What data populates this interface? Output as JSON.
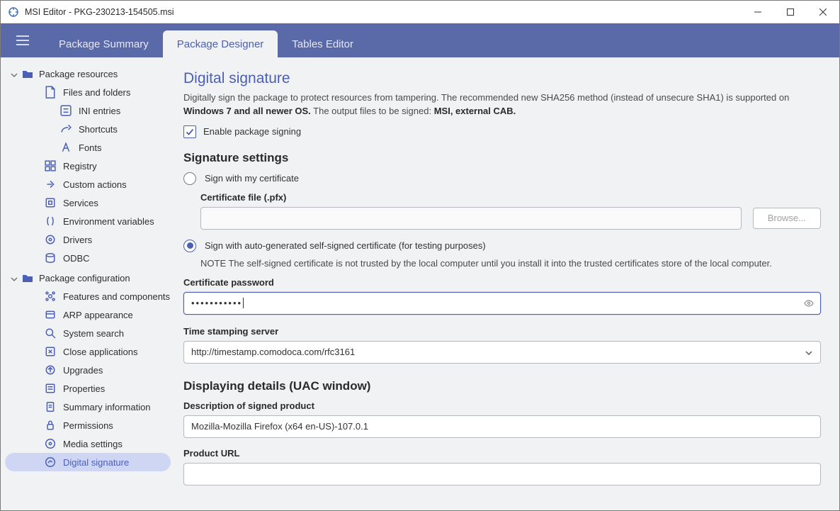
{
  "window": {
    "title": "MSI Editor - PKG-230213-154505.msi"
  },
  "topnav": {
    "tabs": [
      {
        "label": "Package Summary",
        "active": false
      },
      {
        "label": "Package Designer",
        "active": true
      },
      {
        "label": "Tables Editor",
        "active": false
      }
    ]
  },
  "sidebar": {
    "groups": [
      {
        "label": "Package resources",
        "items": [
          {
            "id": "files-folders",
            "label": "Files and folders",
            "icon": "file-icon",
            "children": [
              {
                "id": "ini",
                "label": "INI entries",
                "icon": "ini-icon"
              },
              {
                "id": "shortcuts",
                "label": "Shortcuts",
                "icon": "shortcut-icon"
              },
              {
                "id": "fonts",
                "label": "Fonts",
                "icon": "font-icon"
              }
            ]
          },
          {
            "id": "registry",
            "label": "Registry",
            "icon": "registry-icon"
          },
          {
            "id": "custom-actions",
            "label": "Custom actions",
            "icon": "action-icon"
          },
          {
            "id": "services",
            "label": "Services",
            "icon": "service-icon"
          },
          {
            "id": "env-vars",
            "label": "Environment variables",
            "icon": "env-icon"
          },
          {
            "id": "drivers",
            "label": "Drivers",
            "icon": "driver-icon"
          },
          {
            "id": "odbc",
            "label": "ODBC",
            "icon": "odbc-icon"
          }
        ]
      },
      {
        "label": "Package configuration",
        "items": [
          {
            "id": "features",
            "label": "Features and components",
            "icon": "features-icon"
          },
          {
            "id": "arp",
            "label": "ARP appearance",
            "icon": "arp-icon"
          },
          {
            "id": "system-search",
            "label": "System search",
            "icon": "search-icon"
          },
          {
            "id": "close-apps",
            "label": "Close applications",
            "icon": "close-icon"
          },
          {
            "id": "upgrades",
            "label": "Upgrades",
            "icon": "upgrade-icon"
          },
          {
            "id": "properties",
            "label": "Properties",
            "icon": "properties-icon"
          },
          {
            "id": "summary-info",
            "label": "Summary information",
            "icon": "summary-icon"
          },
          {
            "id": "permissions",
            "label": "Permissions",
            "icon": "permissions-icon"
          },
          {
            "id": "media",
            "label": "Media settings",
            "icon": "media-icon"
          },
          {
            "id": "digital-signature",
            "label": "Digital signature",
            "icon": "signature-icon",
            "selected": true
          }
        ]
      }
    ]
  },
  "page": {
    "title": "Digital signature",
    "desc_pre": "Digitally sign the package to protect resources from tampering. The recommended new SHA256 method (instead of unsecure SHA1) is supported on ",
    "desc_bold1": "Windows 7 and all newer OS.",
    "desc_mid": " The output files to be signed: ",
    "desc_bold2": "MSI, external CAB.",
    "enable_label": "Enable package signing",
    "enable_checked": true,
    "section_settings": "Signature settings",
    "radio1_label": "Sign with my certificate",
    "cert_file_label": "Certificate file (.pfx)",
    "cert_file_value": "",
    "browse_label": "Browse...",
    "radio2_label": "Sign with auto-generated self-signed certificate (for testing purposes)",
    "radio_selected": 2,
    "note": "NOTE The self-signed certificate is not trusted by the local computer until you install it into the trusted certificates store of the local computer.",
    "cert_pwd_label": "Certificate password",
    "cert_pwd_value": "•••••••••••",
    "ts_label": "Time stamping server",
    "ts_value": "http://timestamp.comodoca.com/rfc3161",
    "section_uac": "Displaying details (UAC window)",
    "desc_label": "Description of signed product",
    "desc_value": "Mozilla-Mozilla Firefox (x64 en-US)-107.0.1",
    "url_label": "Product URL",
    "url_value": ""
  }
}
